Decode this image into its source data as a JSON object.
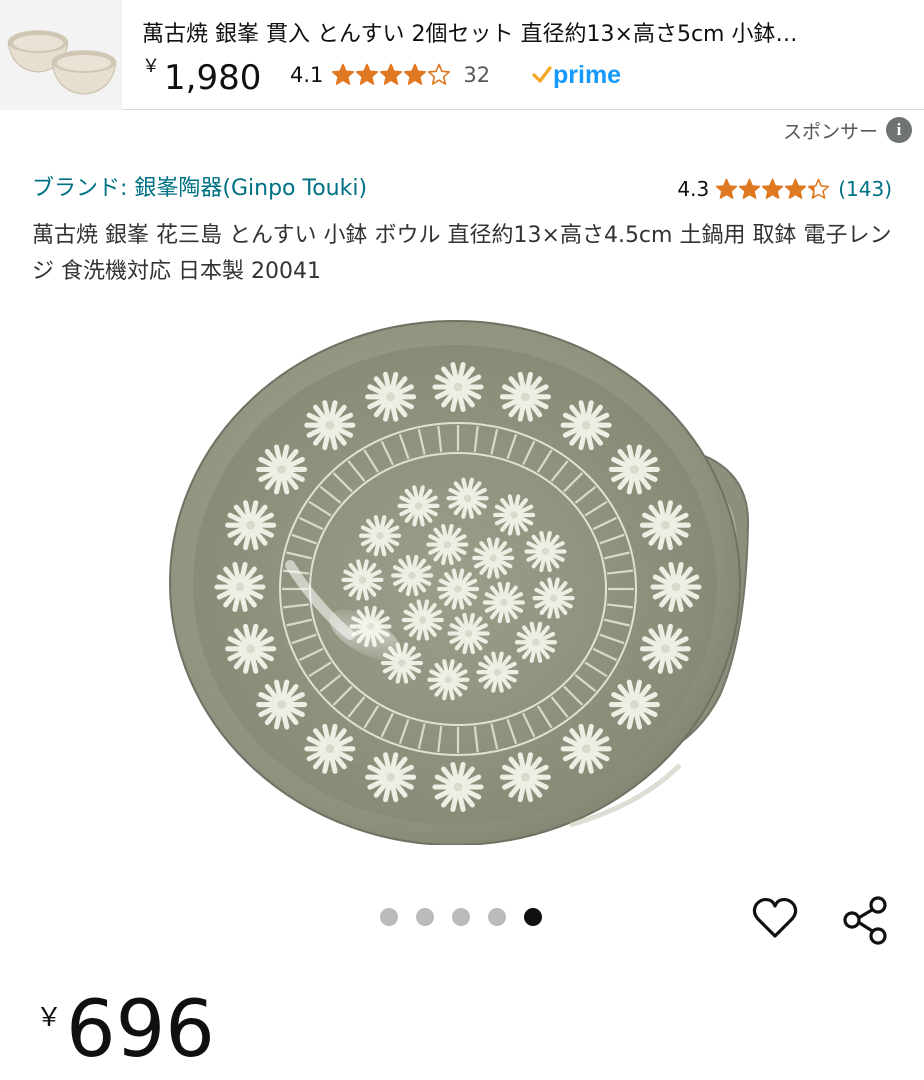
{
  "sponsored_product": {
    "title": "萬古焼 銀峯 貫入 とんすい 2個セット 直径約13×高さ5cm 小鉢…",
    "price_symbol": "￥",
    "price": "1,980",
    "rating": "4.1",
    "rating_value": 4.1,
    "review_count": "32",
    "prime_label": "prime"
  },
  "sponsored_label": "スポンサー",
  "product": {
    "brand": "ブランド: 銀峯陶器(Ginpo Touki)",
    "rating": "4.3",
    "rating_value": 4.3,
    "review_count": "(143)",
    "title": "萬古焼 銀峯 花三島 とんすい 小鉢 ボウル 直径約13×高さ4.5cm 土鍋用 取鉢 電子レンジ 食洗機対応 日本製 20041",
    "price_symbol": "￥",
    "price": "696"
  },
  "carousel": {
    "total": 5,
    "active_index": 4
  },
  "icons": {
    "wishlist": "heart-icon",
    "share": "share-icon",
    "info": "info-icon"
  },
  "colors": {
    "link": "#007185",
    "star": "#de7921",
    "prime": "#1399ff",
    "dot_active": "#0f1111",
    "dot_inactive": "#bbbbbb",
    "bowl_glaze": "#9b9d88"
  }
}
